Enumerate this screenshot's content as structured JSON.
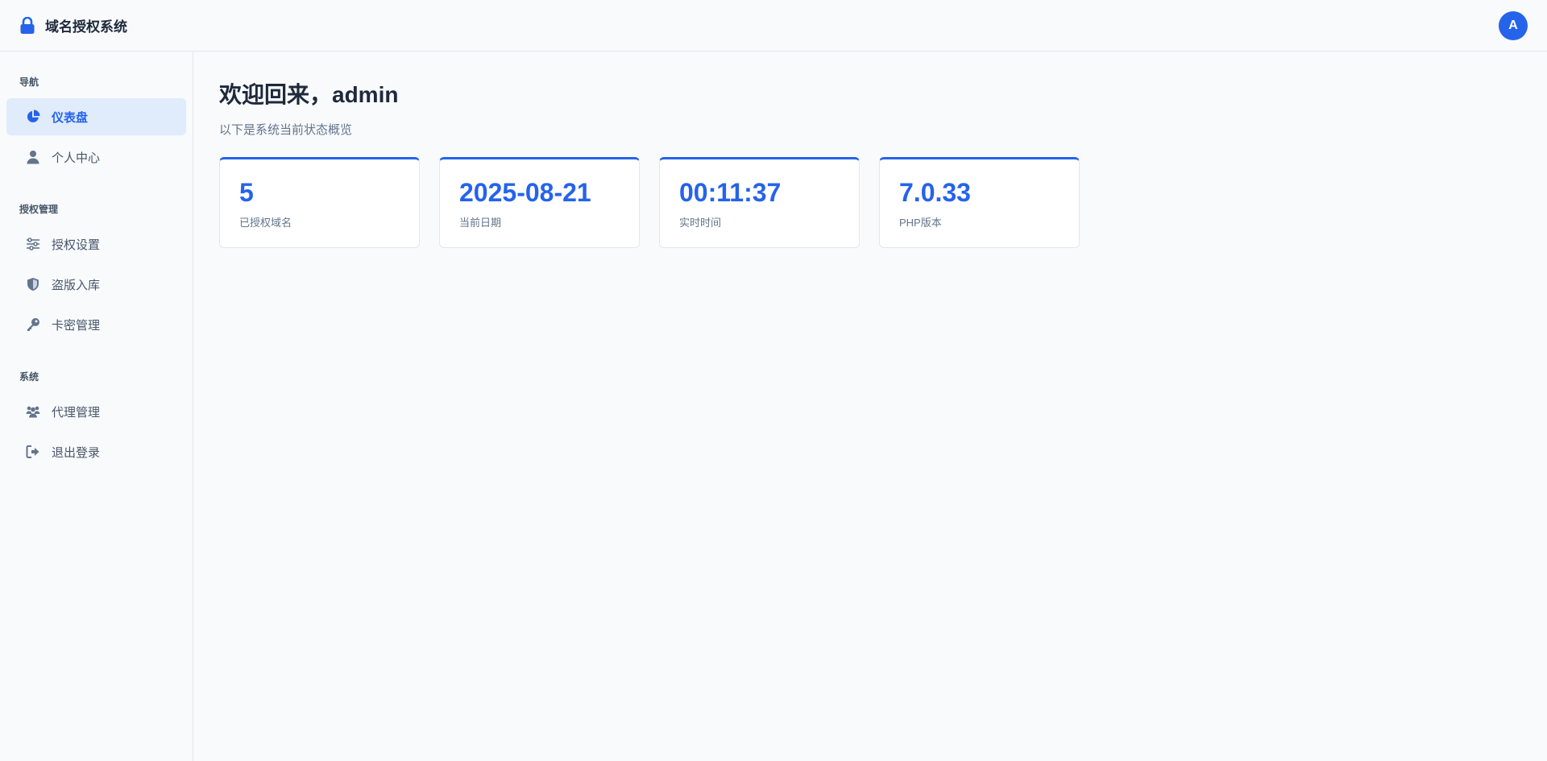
{
  "header": {
    "title": "域名授权系统",
    "avatar_letter": "A",
    "icon": "lock-icon",
    "accent_color": "#2563eb"
  },
  "sidebar": {
    "sections": [
      {
        "label": "导航",
        "items": [
          {
            "label": "仪表盘",
            "icon": "pie-chart-icon",
            "active": true
          },
          {
            "label": "个人中心",
            "icon": "user-icon",
            "active": false
          }
        ]
      },
      {
        "label": "授权管理",
        "items": [
          {
            "label": "授权设置",
            "icon": "sliders-icon",
            "active": false
          },
          {
            "label": "盗版入库",
            "icon": "shield-icon",
            "active": false
          },
          {
            "label": "卡密管理",
            "icon": "key-icon",
            "active": false
          }
        ]
      },
      {
        "label": "系统",
        "items": [
          {
            "label": "代理管理",
            "icon": "users-icon",
            "active": false
          },
          {
            "label": "退出登录",
            "icon": "logout-icon",
            "active": false
          }
        ]
      }
    ]
  },
  "main": {
    "welcome": "欢迎回来，admin",
    "subtitle": "以下是系统当前状态概览",
    "cards": [
      {
        "value": "5",
        "label": "已授权域名"
      },
      {
        "value": "2025-08-21",
        "label": "当前日期"
      },
      {
        "value": "00:11:37",
        "label": "实时时间"
      },
      {
        "value": "7.0.33",
        "label": "PHP版本"
      }
    ]
  }
}
